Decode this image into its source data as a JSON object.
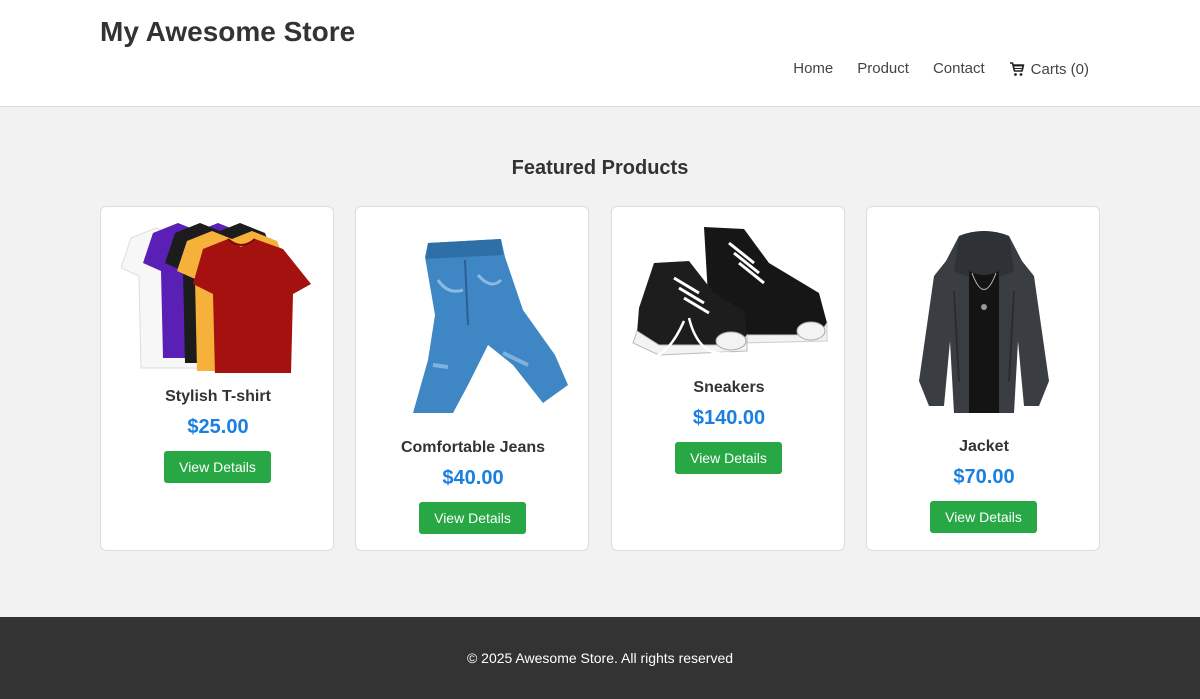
{
  "header": {
    "brand": "My Awesome Store",
    "nav": [
      "Home",
      "Product",
      "Contact"
    ],
    "cart_label": "Carts (0)"
  },
  "main": {
    "title": "Featured Products",
    "products": [
      {
        "name": "Stylish T-shirt",
        "price": "$25.00",
        "button": "View Details",
        "image": "tshirt-stack"
      },
      {
        "name": "Comfortable Jeans",
        "price": "$40.00",
        "button": "View Details",
        "image": "jeans"
      },
      {
        "name": "Sneakers",
        "price": "$140.00",
        "button": "View Details",
        "image": "sneakers"
      },
      {
        "name": "Jacket",
        "price": "$70.00",
        "button": "View Details",
        "image": "jacket"
      }
    ]
  },
  "footer": {
    "text": "© 2025 Awesome Store. All rights reserved"
  },
  "colors": {
    "price": "#1a7fe0",
    "button": "#28a745",
    "footer_bg": "#333333",
    "page_bg": "#f2f2f2"
  }
}
